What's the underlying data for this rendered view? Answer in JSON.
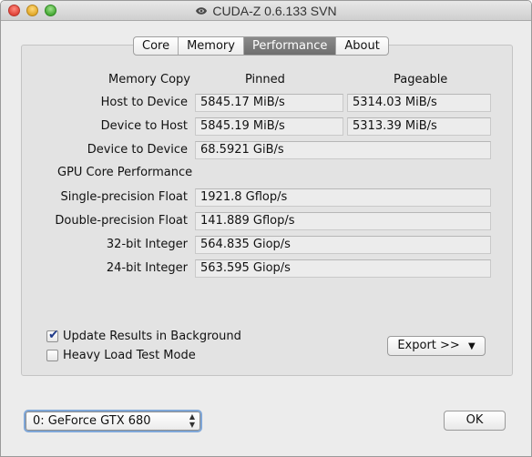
{
  "window": {
    "title": "CUDA-Z 0.6.133 SVN"
  },
  "tabs": [
    {
      "label": "Core"
    },
    {
      "label": "Memory"
    },
    {
      "label": "Performance"
    },
    {
      "label": "About"
    }
  ],
  "memory": {
    "heading": "Memory Copy",
    "pinned_header": "Pinned",
    "pageable_header": "Pageable",
    "rows": [
      {
        "label": "Host to Device",
        "pinned": "5845.17 MiB/s",
        "pageable": "5314.03 MiB/s"
      },
      {
        "label": "Device to Host",
        "pinned": "5845.19 MiB/s",
        "pageable": "5313.39 MiB/s"
      },
      {
        "label": "Device to Device",
        "value": "68.5921 GiB/s"
      }
    ]
  },
  "gpu": {
    "heading": "GPU Core Performance",
    "rows": [
      {
        "label": "Single-precision Float",
        "value": "1921.8 Gflop/s"
      },
      {
        "label": "Double-precision Float",
        "value": "141.889 Gflop/s"
      },
      {
        "label": "32-bit Integer",
        "value": "564.835 Giop/s"
      },
      {
        "label": "24-bit Integer",
        "value": "563.595 Giop/s"
      }
    ]
  },
  "options": {
    "update_background": {
      "label": "Update Results in Background",
      "checked": true
    },
    "heavy_load": {
      "label": "Heavy Load Test Mode",
      "checked": false
    }
  },
  "export_button": {
    "label": "Export >>"
  },
  "device_select": {
    "selected": "0: GeForce GTX 680"
  },
  "ok_button": {
    "label": "OK"
  },
  "colors": {
    "accent": "#7fa7d8",
    "active_tab": "#7a7a7a",
    "panel": "#e3e3e3"
  }
}
